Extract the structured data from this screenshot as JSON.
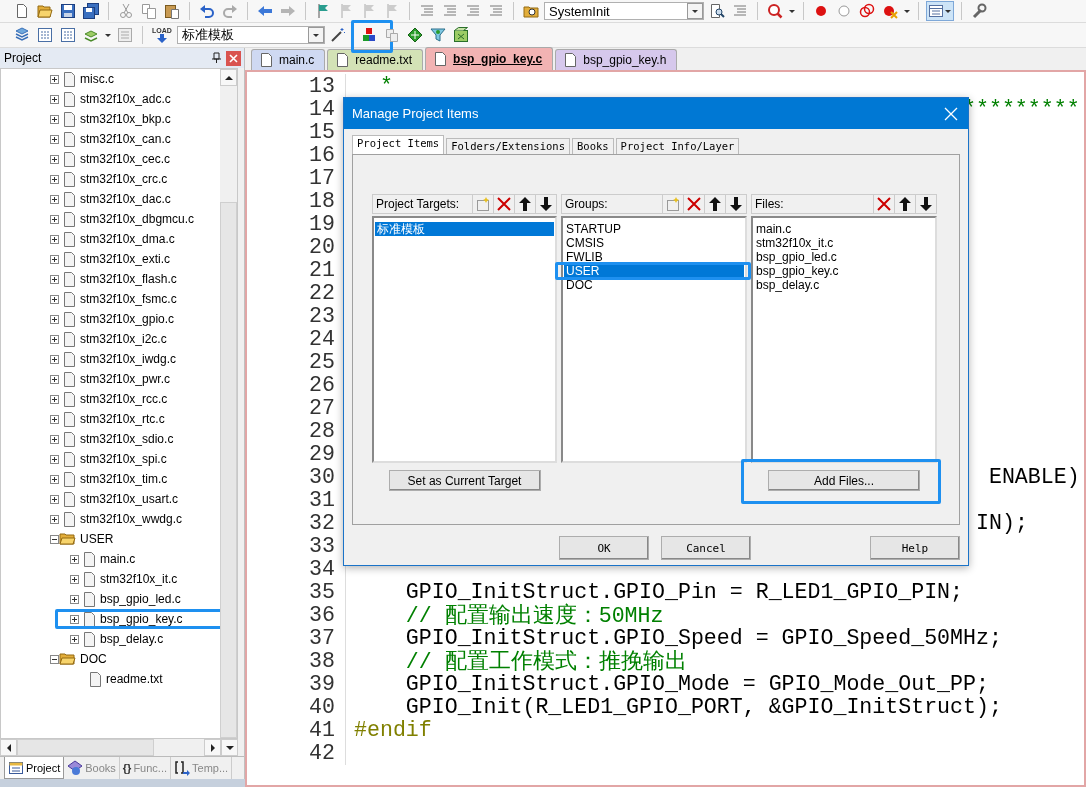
{
  "toolbar": {
    "function_combo": "SystemInit",
    "target_combo": "标准模板",
    "load_label": "LOAD",
    "manage_tool": {
      "highlighted": true
    }
  },
  "project_panel": {
    "title": "Project",
    "tree": [
      {
        "kind": "continued",
        "children": [
          {
            "label": "misc.c",
            "kind": "file",
            "expandable": true,
            "highlighted": false
          },
          {
            "label": "stm32f10x_adc.c",
            "kind": "file",
            "expandable": true,
            "highlighted": false
          },
          {
            "label": "stm32f10x_bkp.c",
            "kind": "file",
            "expandable": true,
            "highlighted": false
          },
          {
            "label": "stm32f10x_can.c",
            "kind": "file",
            "expandable": true,
            "highlighted": false
          },
          {
            "label": "stm32f10x_cec.c",
            "kind": "file",
            "expandable": true,
            "highlighted": false
          },
          {
            "label": "stm32f10x_crc.c",
            "kind": "file",
            "expandable": true,
            "highlighted": false
          },
          {
            "label": "stm32f10x_dac.c",
            "kind": "file",
            "expandable": true,
            "highlighted": false
          },
          {
            "label": "stm32f10x_dbgmcu.c",
            "kind": "file",
            "expandable": true,
            "highlighted": false
          },
          {
            "label": "stm32f10x_dma.c",
            "kind": "file",
            "expandable": true,
            "highlighted": false
          },
          {
            "label": "stm32f10x_exti.c",
            "kind": "file",
            "expandable": true,
            "highlighted": false
          },
          {
            "label": "stm32f10x_flash.c",
            "kind": "file",
            "expandable": true,
            "highlighted": false
          },
          {
            "label": "stm32f10x_fsmc.c",
            "kind": "file",
            "expandable": true,
            "highlighted": false
          },
          {
            "label": "stm32f10x_gpio.c",
            "kind": "file",
            "expandable": true,
            "highlighted": false
          },
          {
            "label": "stm32f10x_i2c.c",
            "kind": "file",
            "expandable": true,
            "highlighted": false
          },
          {
            "label": "stm32f10x_iwdg.c",
            "kind": "file",
            "expandable": true,
            "highlighted": false
          },
          {
            "label": "stm32f10x_pwr.c",
            "kind": "file",
            "expandable": true,
            "highlighted": false
          },
          {
            "label": "stm32f10x_rcc.c",
            "kind": "file",
            "expandable": true,
            "highlighted": false
          },
          {
            "label": "stm32f10x_rtc.c",
            "kind": "file",
            "expandable": true,
            "highlighted": false
          },
          {
            "label": "stm32f10x_sdio.c",
            "kind": "file",
            "expandable": true,
            "highlighted": false
          },
          {
            "label": "stm32f10x_spi.c",
            "kind": "file",
            "expandable": true,
            "highlighted": false
          },
          {
            "label": "stm32f10x_tim.c",
            "kind": "file",
            "expandable": true,
            "highlighted": false
          },
          {
            "label": "stm32f10x_usart.c",
            "kind": "file",
            "expandable": true,
            "highlighted": false
          },
          {
            "label": "stm32f10x_wwdg.c",
            "kind": "file",
            "expandable": true,
            "highlighted": false
          }
        ]
      },
      {
        "label": "USER",
        "kind": "group",
        "expanded": true,
        "children": [
          {
            "label": "main.c",
            "kind": "file",
            "expandable": true,
            "highlighted": false
          },
          {
            "label": "stm32f10x_it.c",
            "kind": "file",
            "expandable": true,
            "highlighted": false
          },
          {
            "label": "bsp_gpio_led.c",
            "kind": "file",
            "expandable": true,
            "highlighted": false
          },
          {
            "label": "bsp_gpio_key.c",
            "kind": "file",
            "expandable": true,
            "highlighted": true
          },
          {
            "label": "bsp_delay.c",
            "kind": "file",
            "expandable": true,
            "highlighted": false
          }
        ]
      },
      {
        "label": "DOC",
        "kind": "group",
        "expanded": true,
        "children": [
          {
            "label": "readme.txt",
            "kind": "file",
            "expandable": false,
            "highlighted": false
          }
        ]
      }
    ],
    "tabs": [
      {
        "label": "Project",
        "kind": "project",
        "selected": true
      },
      {
        "label": "Books",
        "kind": "books",
        "selected": false
      },
      {
        "label": "Func...",
        "kind": "functions",
        "glyph": "{}",
        "selected": false
      },
      {
        "label": "Temp...",
        "kind": "templates",
        "selected": false
      }
    ]
  },
  "editor": {
    "tabs": [
      {
        "label": "main.c",
        "color": "#cfd9f2",
        "selected": false
      },
      {
        "label": "readme.txt",
        "color": "#d3e2b6",
        "selected": false
      },
      {
        "label": "bsp_gpio_key.c",
        "color": "#f2b3b3",
        "selected": true
      },
      {
        "label": "bsp_gpio_key.h",
        "color": "#d6c8ec",
        "selected": false
      }
    ],
    "lines": [
      {
        "number": "13",
        "kind": "doc",
        "text": "*"
      },
      {
        "number": "14",
        "kind": "tail-comment",
        "text": "*********"
      },
      {
        "number": "15"
      },
      {
        "number": "16"
      },
      {
        "number": "17"
      },
      {
        "number": "18"
      },
      {
        "number": "19"
      },
      {
        "number": "20"
      },
      {
        "number": "21"
      },
      {
        "number": "22"
      },
      {
        "number": "23"
      },
      {
        "number": "24"
      },
      {
        "number": "25"
      },
      {
        "number": "26"
      },
      {
        "number": "27"
      },
      {
        "number": "28"
      },
      {
        "number": "29"
      },
      {
        "number": "30",
        "kind": "tail-far",
        "text": "ENABLE)"
      },
      {
        "number": "31"
      },
      {
        "number": "32",
        "kind": "tail",
        "text": "IN);"
      },
      {
        "number": "33"
      },
      {
        "number": "34"
      },
      {
        "number": "35",
        "kind": "code",
        "text": "GPIO_InitStruct.GPIO_Pin = R_LED1_GPIO_PIN;"
      },
      {
        "number": "36",
        "kind": "comment",
        "text": "// 配置输出速度：50MHz"
      },
      {
        "number": "37",
        "kind": "code",
        "text": "GPIO_InitStruct.GPIO_Speed = GPIO_Speed_50MHz;"
      },
      {
        "number": "38",
        "kind": "comment",
        "text": "// 配置工作模式：推挽输出"
      },
      {
        "number": "39",
        "kind": "code",
        "text": "GPIO_InitStruct.GPIO_Mode = GPIO_Mode_Out_PP;"
      },
      {
        "number": "40",
        "kind": "code",
        "text": "GPIO_Init(R_LED1_GPIO_PORT, &GPIO_InitStruct);"
      },
      {
        "number": "41",
        "kind": "directive",
        "text": "#endif"
      },
      {
        "number": "42"
      }
    ]
  },
  "dialog": {
    "title": "Manage Project Items",
    "tabs": [
      {
        "label": "Project Items",
        "selected": true
      },
      {
        "label": "Folders/Extensions",
        "selected": false
      },
      {
        "label": "Books",
        "selected": false
      },
      {
        "label": "Project Info/Layer",
        "selected": false
      }
    ],
    "lists": [
      {
        "label": "Project Targets:",
        "tools": [
          {
            "kind": "new"
          },
          {
            "kind": "delete"
          },
          {
            "kind": "up"
          },
          {
            "kind": "down"
          }
        ],
        "items": [
          {
            "text": "标准模板",
            "selected": true,
            "highlighted": false
          }
        ],
        "button": {
          "label": "Set as Current Target",
          "highlighted": false
        }
      },
      {
        "label": "Groups:",
        "tools": [
          {
            "kind": "new"
          },
          {
            "kind": "delete"
          },
          {
            "kind": "up"
          },
          {
            "kind": "down"
          }
        ],
        "items": [
          {
            "text": "STARTUP",
            "selected": false,
            "highlighted": false
          },
          {
            "text": "CMSIS",
            "selected": false,
            "highlighted": false
          },
          {
            "text": "FWLIB",
            "selected": false,
            "highlighted": false
          },
          {
            "text": "USER",
            "selected": true,
            "highlighted": true
          },
          {
            "text": "DOC",
            "selected": false,
            "highlighted": false
          }
        ]
      },
      {
        "label": "Files:",
        "tools": [
          {
            "kind": "delete"
          },
          {
            "kind": "up"
          },
          {
            "kind": "down"
          }
        ],
        "items": [
          {
            "text": "main.c",
            "selected": false,
            "highlighted": false
          },
          {
            "text": "stm32f10x_it.c",
            "selected": false,
            "highlighted": false
          },
          {
            "text": "bsp_gpio_led.c",
            "selected": false,
            "highlighted": false
          },
          {
            "text": "bsp_gpio_key.c",
            "selected": false,
            "highlighted": false
          },
          {
            "text": "bsp_delay.c",
            "selected": false,
            "highlighted": false
          }
        ],
        "button": {
          "label": "Add Files...",
          "highlighted": true
        }
      }
    ],
    "buttons": [
      {
        "label": "OK"
      },
      {
        "label": "Cancel"
      },
      {
        "label": "Help"
      }
    ]
  }
}
